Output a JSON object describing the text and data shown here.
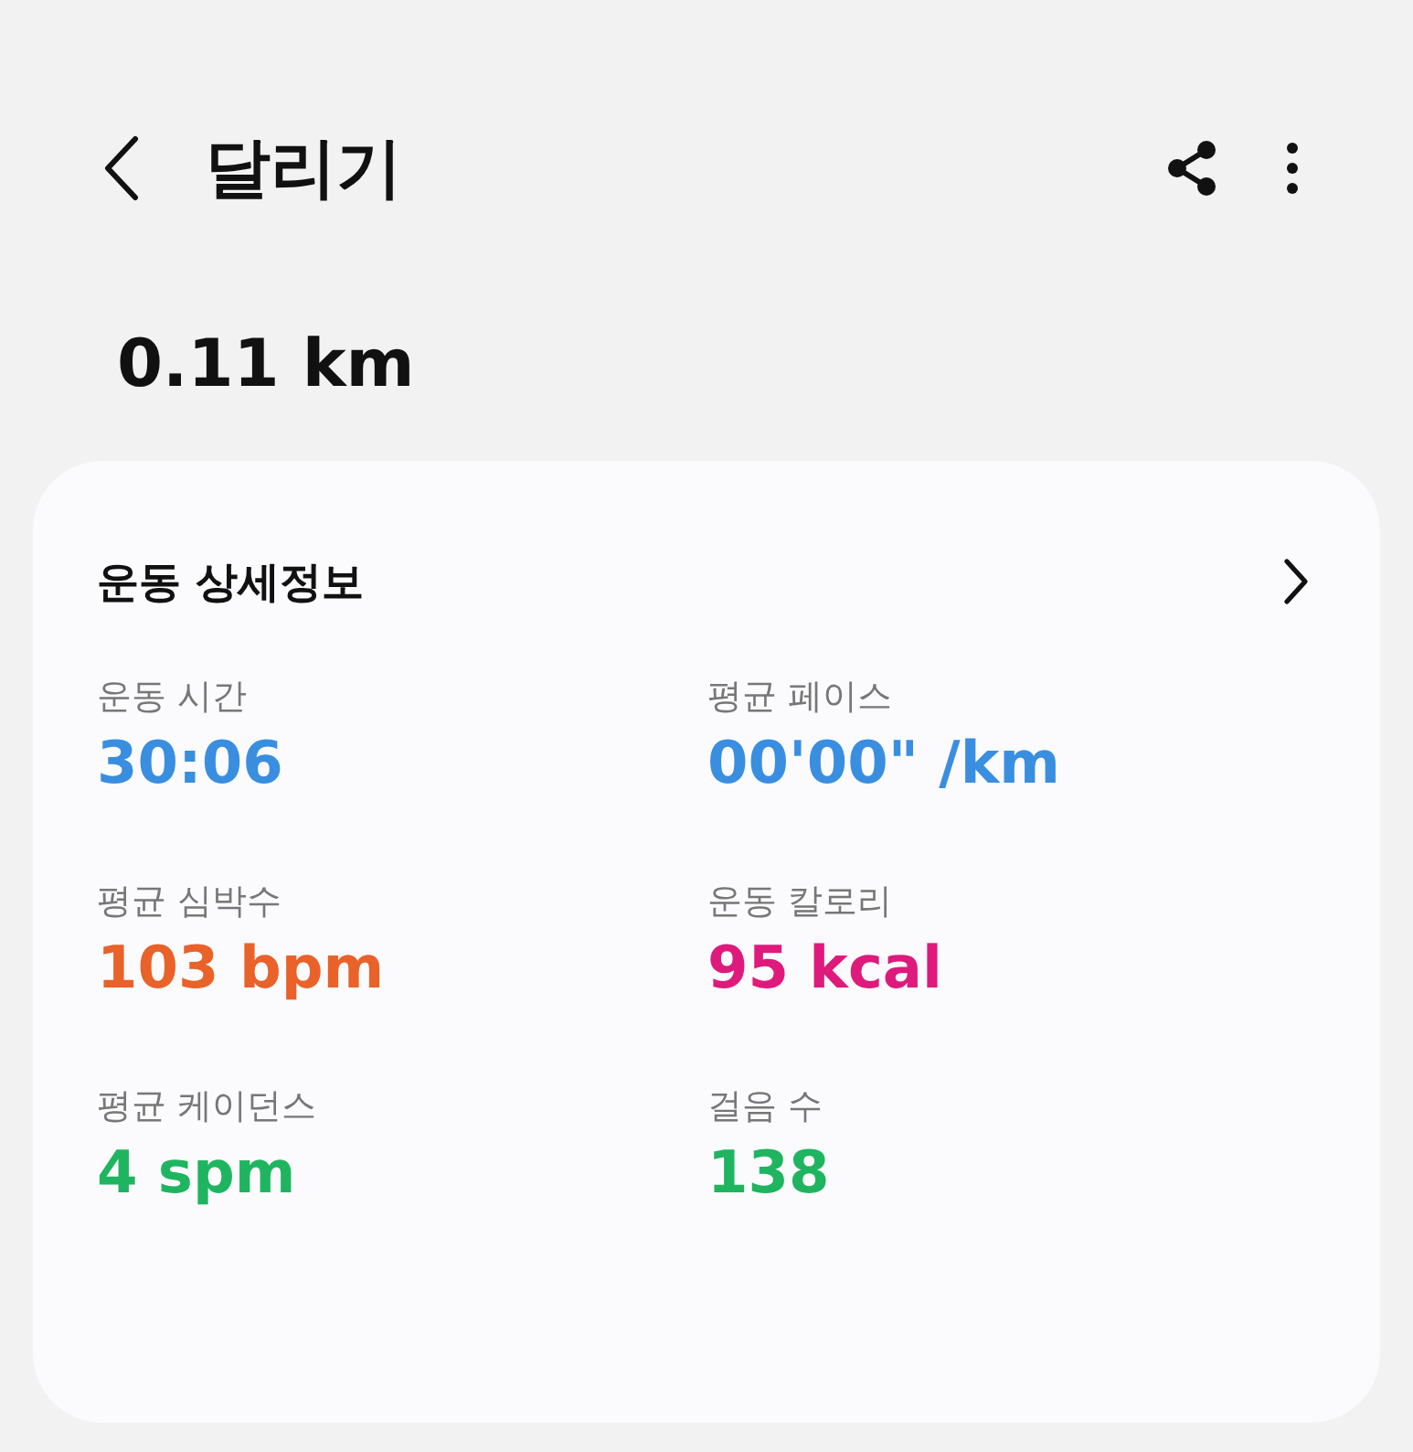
{
  "header": {
    "title": "달리기"
  },
  "distance": "0.11 km",
  "details": {
    "title": "운동 상세정보",
    "stats": [
      {
        "label": "운동 시간",
        "value": "30:06",
        "color": "#3a8ee0"
      },
      {
        "label": "평균 페이스",
        "value": "00'00\" /km",
        "color": "#3a8ee0"
      },
      {
        "label": "평균 심박수",
        "value": "103 bpm",
        "color": "#e8622a"
      },
      {
        "label": "운동 칼로리",
        "value": "95 kcal",
        "color": "#de1a7c"
      },
      {
        "label": "평균 케이던스",
        "value": "4 spm",
        "color": "#1fb560"
      },
      {
        "label": "걸음 수",
        "value": "138",
        "color": "#1fb560"
      }
    ]
  }
}
